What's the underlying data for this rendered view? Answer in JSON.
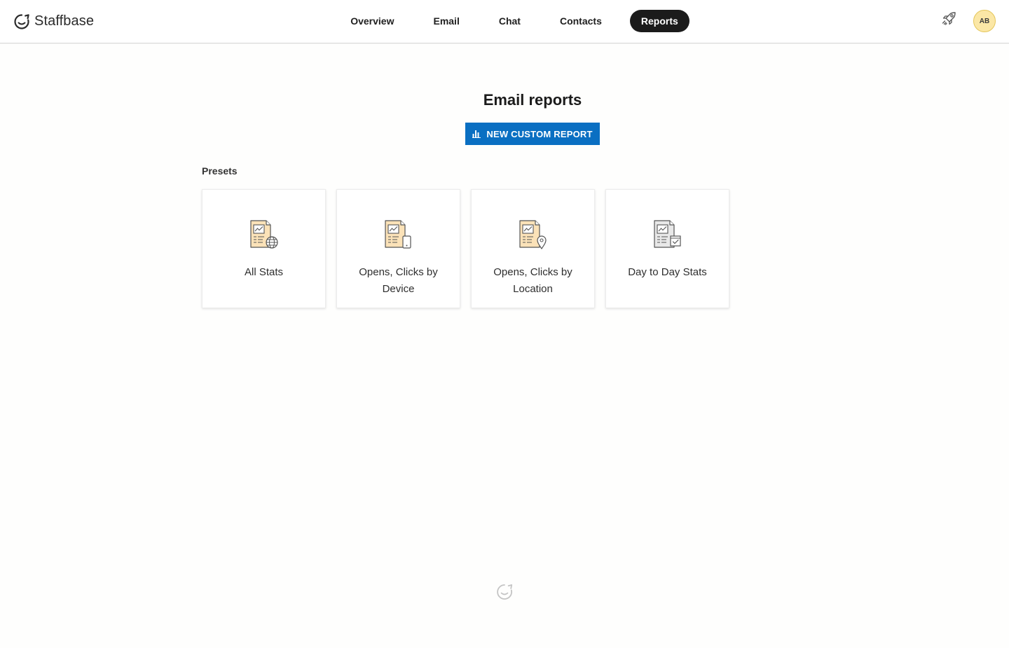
{
  "brand": {
    "name": "Staffbase"
  },
  "nav": {
    "items": [
      {
        "label": "Overview",
        "active": false
      },
      {
        "label": "Email",
        "active": false
      },
      {
        "label": "Chat",
        "active": false
      },
      {
        "label": "Contacts",
        "active": false
      },
      {
        "label": "Reports",
        "active": true
      }
    ]
  },
  "user": {
    "initials": "AB"
  },
  "main": {
    "title": "Email reports",
    "new_report_label": "NEW CUSTOM REPORT",
    "presets_label": "Presets",
    "presets": [
      {
        "label": "All Stats",
        "icon": "report-globe-icon"
      },
      {
        "label": "Opens, Clicks by Device",
        "icon": "report-device-icon"
      },
      {
        "label": "Opens, Clicks by Location",
        "icon": "report-location-icon"
      },
      {
        "label": "Day to Day Stats",
        "icon": "report-calendar-icon"
      }
    ]
  },
  "colors": {
    "accent": "#0a6fc2",
    "nav_active_bg": "#1b1b1b",
    "avatar_bg": "#fbe7a6",
    "icon_doc_fill": "#fbe2b8"
  }
}
